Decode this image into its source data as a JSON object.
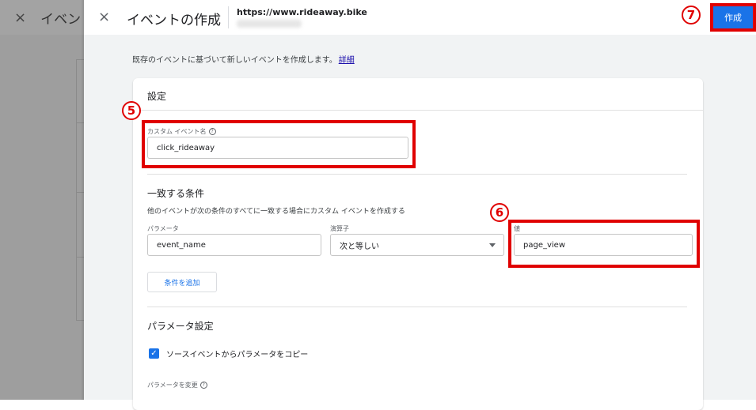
{
  "background": {
    "close_icon": "×",
    "title": "イベン"
  },
  "header": {
    "close_icon": "×",
    "title": "イベントの作成",
    "url": "https://www.rideaway.bike",
    "create_label": "作成"
  },
  "description": {
    "text": "既存のイベントに基づいて新しいイベントを作成します。",
    "link": "詳細"
  },
  "settings": {
    "title": "設定",
    "custom_event_label": "カスタム イベント名",
    "custom_event_value": "click_rideaway",
    "help_icon": "?"
  },
  "conditions": {
    "title": "一致する条件",
    "description": "他のイベントが次の条件のすべてに一致する場合にカスタム イベントを作成する",
    "param_label": "パラメータ",
    "param_value": "event_name",
    "operator_label": "演算子",
    "operator_value": "次と等しい",
    "value_label": "値",
    "value_value": "page_view",
    "add_condition_label": "条件を追加"
  },
  "param_settings": {
    "title": "パラメータ設定",
    "copy_checkbox_label": "ソースイベントからパラメータをコピー",
    "copy_checked": true,
    "modify_label": "パラメータを変更"
  },
  "markers": {
    "five": "5",
    "six": "6",
    "seven": "7"
  },
  "colors": {
    "accent": "#1a73e8",
    "highlight": "#e00000"
  }
}
